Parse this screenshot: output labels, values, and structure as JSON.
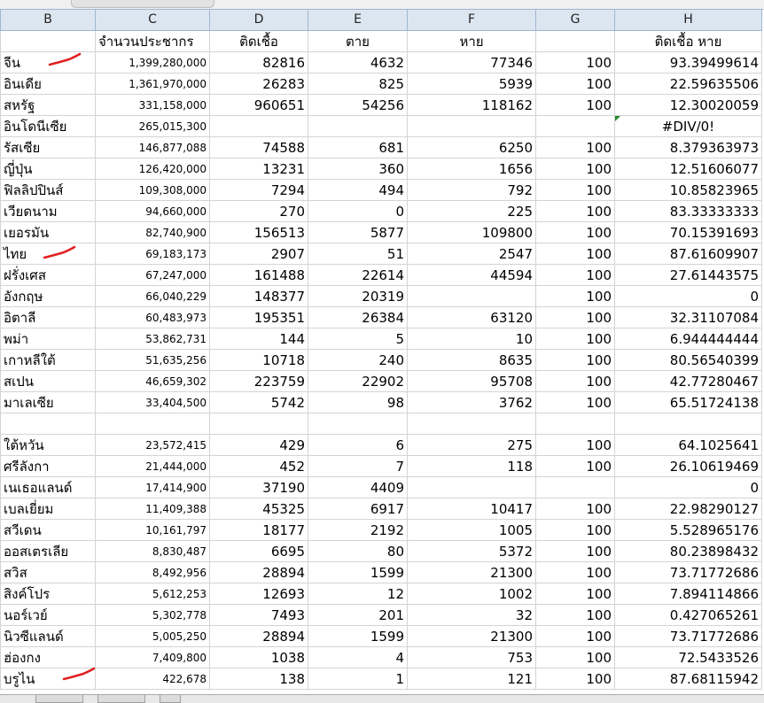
{
  "columns": [
    "B",
    "C",
    "D",
    "E",
    "F",
    "G",
    "H"
  ],
  "header_row": {
    "c": "จำนวนประชากร",
    "d": "ติดเชื้อ",
    "e": "ตาย",
    "f": "หาย",
    "h": "ติดเชื้อ หาย"
  },
  "rows": [
    {
      "b": "จีน",
      "c": "1,399,280,000",
      "d": "82816",
      "e": "4632",
      "f": "77346",
      "g": "100",
      "h": "93.39499614"
    },
    {
      "b": "อินเดีย",
      "c": "1,361,970,000",
      "d": "26283",
      "e": "825",
      "f": "5939",
      "g": "100",
      "h": "22.59635506"
    },
    {
      "b": "สหรัฐ",
      "c": "331,158,000",
      "d": "960651",
      "e": "54256",
      "f": "118162",
      "g": "100",
      "h": "12.30020059"
    },
    {
      "b": "อินโดนีเซีย",
      "c": "265,015,300",
      "d": "",
      "e": "",
      "f": "",
      "g": "",
      "h": "#DIV/0!",
      "error": true
    },
    {
      "b": "รัสเซีย",
      "c": "146,877,088",
      "d": "74588",
      "e": "681",
      "f": "6250",
      "g": "100",
      "h": "8.379363973"
    },
    {
      "b": "ญี่ปุ่น",
      "c": "126,420,000",
      "d": "13231",
      "e": "360",
      "f": "1656",
      "g": "100",
      "h": "12.51606077"
    },
    {
      "b": "ฟิลลิปปินส์",
      "c": "109,308,000",
      "d": "7294",
      "e": "494",
      "f": "792",
      "g": "100",
      "h": "10.85823965"
    },
    {
      "b": "เวียดนาม",
      "c": "94,660,000",
      "d": "270",
      "e": "0",
      "f": "225",
      "g": "100",
      "h": "83.33333333"
    },
    {
      "b": "เยอรมัน",
      "c": "82,740,900",
      "d": "156513",
      "e": "5877",
      "f": "109800",
      "g": "100",
      "h": "70.15391693"
    },
    {
      "b": "ไทย",
      "c": "69,183,173",
      "d": "2907",
      "e": "51",
      "f": "2547",
      "g": "100",
      "h": "87.61609907"
    },
    {
      "b": "ฝรั่งเศส",
      "c": "67,247,000",
      "d": "161488",
      "e": "22614",
      "f": "44594",
      "g": "100",
      "h": "27.61443575"
    },
    {
      "b": "อังกฤษ",
      "c": "66,040,229",
      "d": "148377",
      "e": "20319",
      "f": "",
      "g": "100",
      "h": "0"
    },
    {
      "b": "อิตาลี",
      "c": "60,483,973",
      "d": "195351",
      "e": "26384",
      "f": "63120",
      "g": "100",
      "h": "32.31107084"
    },
    {
      "b": "พม่า",
      "c": "53,862,731",
      "d": "144",
      "e": "5",
      "f": "10",
      "g": "100",
      "h": "6.944444444"
    },
    {
      "b": "เกาหลีใต้",
      "c": "51,635,256",
      "d": "10718",
      "e": "240",
      "f": "8635",
      "g": "100",
      "h": "80.56540399"
    },
    {
      "b": "สเปน",
      "c": "46,659,302",
      "d": "223759",
      "e": "22902",
      "f": "95708",
      "g": "100",
      "h": "42.77280467"
    },
    {
      "b": "มาเลเซีย",
      "c": "33,404,500",
      "d": "5742",
      "e": "98",
      "f": "3762",
      "g": "100",
      "h": "65.51724138"
    },
    {
      "b": "",
      "c": "",
      "d": "",
      "e": "",
      "f": "",
      "g": "",
      "h": ""
    },
    {
      "b": "ใต้หวัน",
      "c": "23,572,415",
      "d": "429",
      "e": "6",
      "f": "275",
      "g": "100",
      "h": "64.1025641"
    },
    {
      "b": "ศรีลังกา",
      "c": "21,444,000",
      "d": "452",
      "e": "7",
      "f": "118",
      "g": "100",
      "h": "26.10619469"
    },
    {
      "b": "เนเธอแลนด์",
      "c": "17,414,900",
      "d": "37190",
      "e": "4409",
      "f": "",
      "g": "",
      "h": "0"
    },
    {
      "b": "เบลเยี่ยม",
      "c": "11,409,388",
      "d": "45325",
      "e": "6917",
      "f": "10417",
      "g": "100",
      "h": "22.98290127"
    },
    {
      "b": "สวีเดน",
      "c": "10,161,797",
      "d": "18177",
      "e": "2192",
      "f": "1005",
      "g": "100",
      "h": "5.528965176"
    },
    {
      "b": "ออสเตรเลีย",
      "c": "8,830,487",
      "d": "6695",
      "e": "80",
      "f": "5372",
      "g": "100",
      "h": "80.23898432"
    },
    {
      "b": "สวิส",
      "c": "8,492,956",
      "d": "28894",
      "e": "1599",
      "f": "21300",
      "g": "100",
      "h": "73.71772686"
    },
    {
      "b": "สิงค์โปร",
      "c": "5,612,253",
      "d": "12693",
      "e": "12",
      "f": "1002",
      "g": "100",
      "h": "7.894114866"
    },
    {
      "b": "นอร์เวย์",
      "c": "5,302,778",
      "d": "7493",
      "e": "201",
      "f": "32",
      "g": "100",
      "h": "0.427065261"
    },
    {
      "b": "นิวซีแลนด์",
      "c": "5,005,250",
      "d": "28894",
      "e": "1599",
      "f": "21300",
      "g": "100",
      "h": "73.71772686"
    },
    {
      "b": "ฮ่องกง",
      "c": "7,409,800",
      "d": "1038",
      "e": "4",
      "f": "753",
      "g": "100",
      "h": "72.5433526"
    },
    {
      "b": "บรูไน",
      "c": "422,678",
      "d": "138",
      "e": "1",
      "f": "121",
      "g": "100",
      "h": "87.68115942"
    }
  ],
  "annotation_color": "#e02020",
  "header_fill": "#dce6f1",
  "gridline_color": "#d4d4d4"
}
